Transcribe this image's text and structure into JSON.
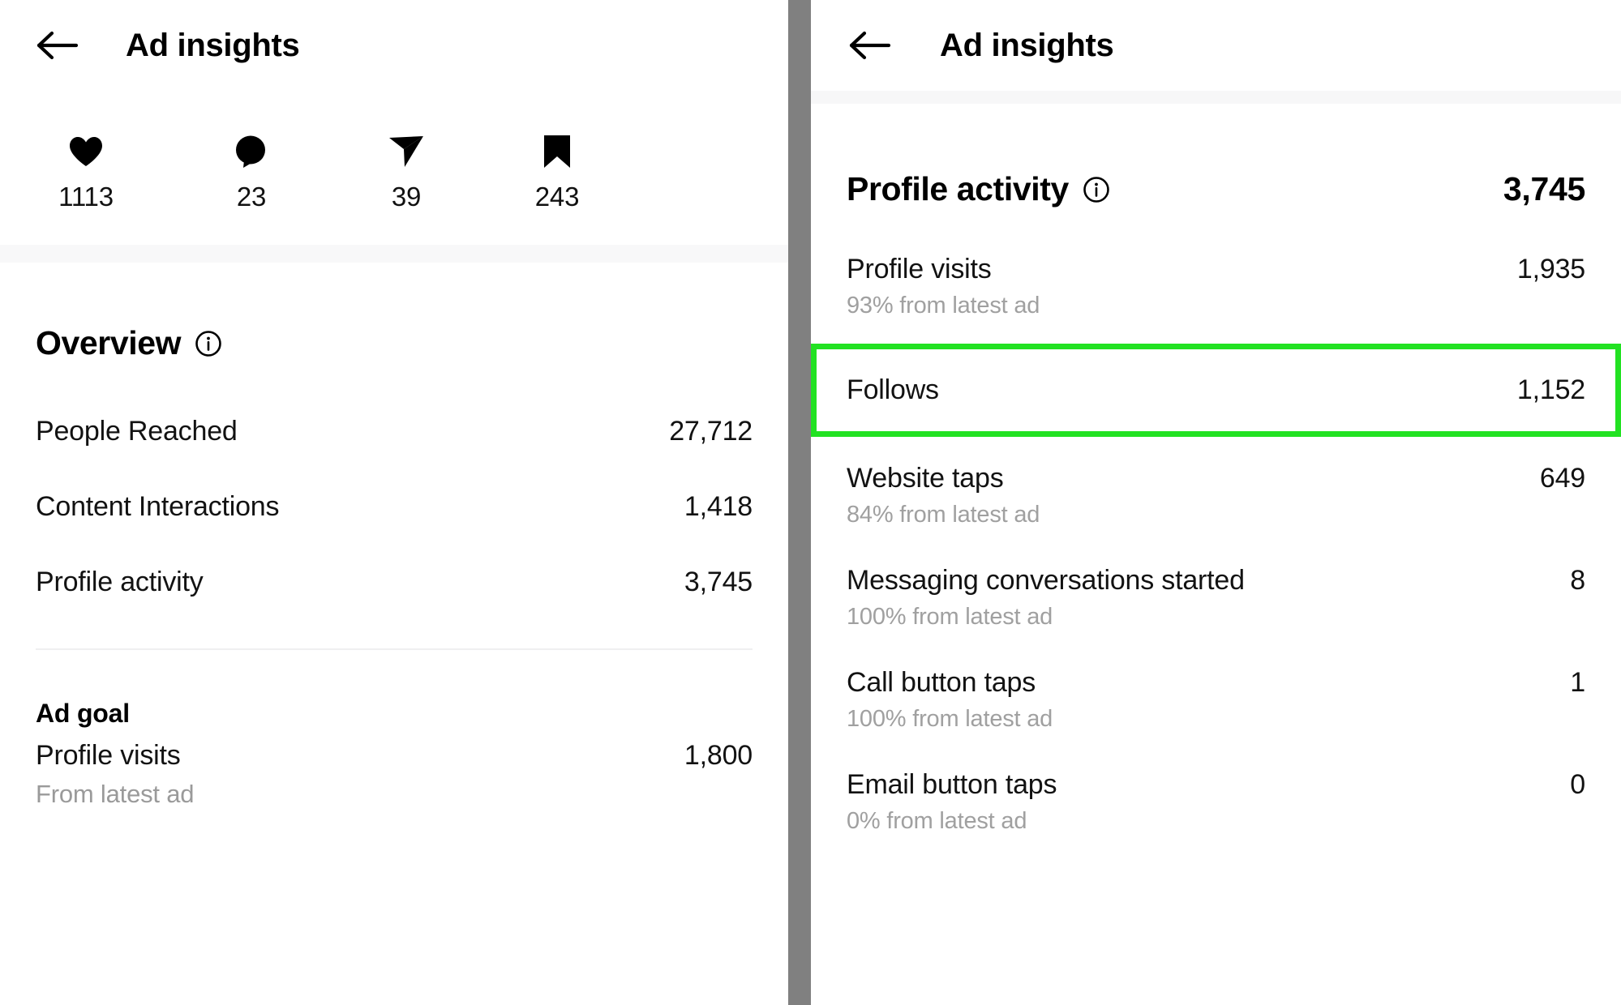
{
  "left_panel": {
    "header": {
      "back_icon": "back-arrow-icon",
      "title": "Ad insights"
    },
    "engagement": [
      {
        "icon": "heart-icon",
        "count": "1113"
      },
      {
        "icon": "comment-icon",
        "count": "23"
      },
      {
        "icon": "share-icon",
        "count": "39"
      },
      {
        "icon": "bookmark-icon",
        "count": "243"
      }
    ],
    "overview": {
      "heading": "Overview",
      "info_icon": "info-icon",
      "rows": [
        {
          "label": "People Reached",
          "value": "27,712"
        },
        {
          "label": "Content Interactions",
          "value": "1,418"
        },
        {
          "label": "Profile activity",
          "value": "3,745"
        }
      ]
    },
    "ad_goal": {
      "title": "Ad goal",
      "label": "Profile visits",
      "value": "1,800",
      "sub": "From latest ad"
    }
  },
  "right_panel": {
    "header": {
      "back_icon": "back-arrow-icon",
      "title": "Ad insights"
    },
    "profile_activity": {
      "heading": "Profile activity",
      "info_icon": "info-icon",
      "total": "3,745",
      "rows": [
        {
          "label": "Profile visits",
          "value": "1,935",
          "sub": "93% from latest ad",
          "highlighted": false
        },
        {
          "label": "Follows",
          "value": "1,152",
          "sub": "",
          "highlighted": true
        },
        {
          "label": "Website taps",
          "value": "649",
          "sub": "84% from latest ad",
          "highlighted": false
        },
        {
          "label": "Messaging conversations started",
          "value": "8",
          "sub": "100% from latest ad",
          "highlighted": false
        },
        {
          "label": "Call button taps",
          "value": "1",
          "sub": "100% from latest ad",
          "highlighted": false
        },
        {
          "label": "Email button taps",
          "value": "0",
          "sub": "0% from latest ad",
          "highlighted": false
        }
      ]
    }
  },
  "colors": {
    "highlight_green": "#22e222",
    "panel_divider_gray": "#808080",
    "muted_text": "#9a9a9a",
    "primary_text": "#121212"
  }
}
